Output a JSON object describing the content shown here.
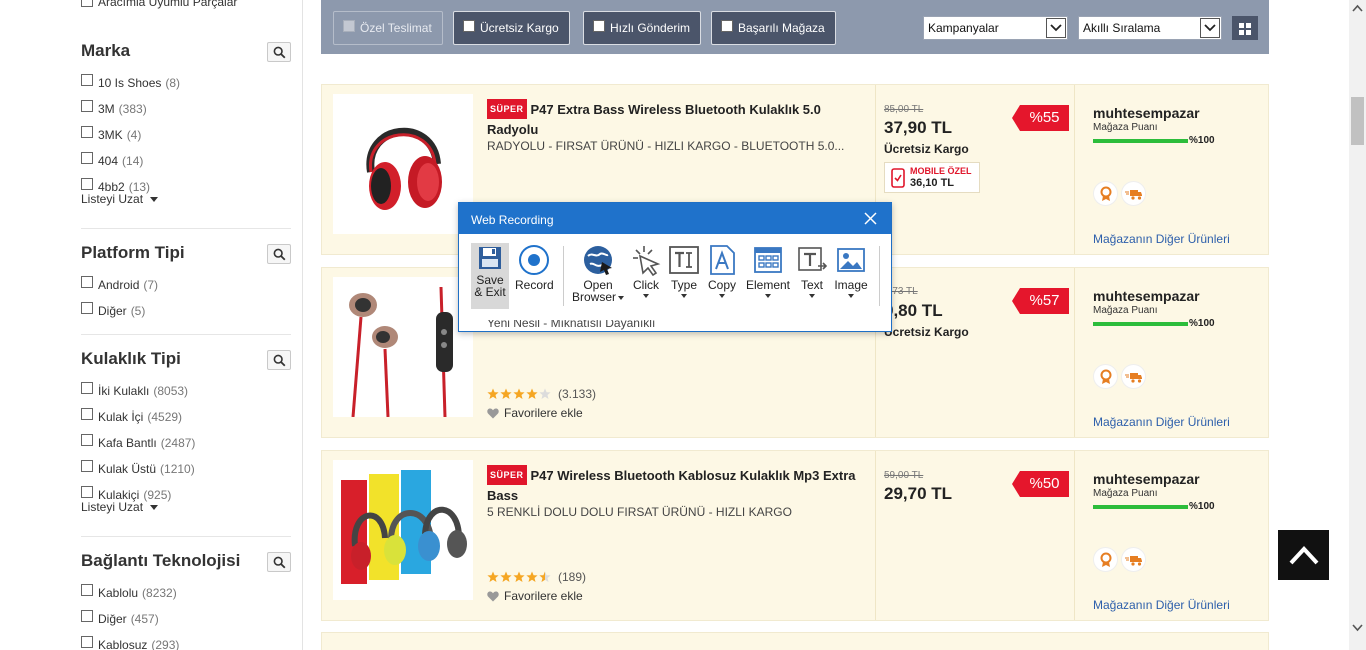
{
  "sidebar": {
    "cut_item": "Aracımla Uyumlu Parçalar",
    "expand_label": "Listeyi Uzat",
    "facets": [
      {
        "title": "Marka",
        "options": [
          {
            "label": "10 Is Shoes",
            "count": "(8)"
          },
          {
            "label": "3M",
            "count": "(383)"
          },
          {
            "label": "3MK",
            "count": "(4)"
          },
          {
            "label": "404",
            "count": "(14)"
          },
          {
            "label": "4bb2",
            "count": "(13)"
          }
        ]
      },
      {
        "title": "Platform Tipi",
        "options": [
          {
            "label": "Android",
            "count": "(7)"
          },
          {
            "label": "Diğer",
            "count": "(5)"
          }
        ]
      },
      {
        "title": "Kulaklık Tipi",
        "options": [
          {
            "label": "İki Kulaklı",
            "count": "(8053)"
          },
          {
            "label": "Kulak İçi",
            "count": "(4529)"
          },
          {
            "label": "Kafa Bantlı",
            "count": "(2487)"
          },
          {
            "label": "Kulak Üstü",
            "count": "(1210)"
          },
          {
            "label": "Kulakiçi",
            "count": "(925)"
          }
        ]
      },
      {
        "title": "Bağlantı Teknolojisi",
        "options": [
          {
            "label": "Kablolu",
            "count": "(8232)"
          },
          {
            "label": "Diğer",
            "count": "(457)"
          },
          {
            "label": "Kablosuz",
            "count": "(293)"
          }
        ]
      }
    ]
  },
  "filterbar": {
    "chips": [
      "Özel Teslimat",
      "Ücretsiz Kargo",
      "Hızlı Gönderim",
      "Başarılı Mağaza"
    ],
    "select_campaign": "Kampanyalar",
    "select_sort": "Akıllı Sıralama"
  },
  "products": [
    {
      "badge": "SÜPER",
      "title": "P47 Extra Bass Wireless Bluetooth Kulaklık 5.0 Radyolu",
      "subtitle": "RADYOLU - FIRSAT ÜRÜNÜ - HIZLI KARGO - BLUETOOTH 5.0...",
      "old_price": "85,00 TL",
      "price": "37,90 TL",
      "shipping": "Ücretsiz Kargo",
      "mobile_label": "MOBILE ÖZEL",
      "mobile_price": "36,10 TL",
      "discount": "%55",
      "store": "muhtesempazar",
      "store_score_label": "Mağaza Puanı",
      "store_score": "%100",
      "store_link": "Mağazanın Diğer Ürünleri"
    },
    {
      "subtitle_partial": "Yeni Nesil - Mıknatıslı Dayanıklı",
      "rating_count": "(3.133)",
      "rating_value": 4,
      "favorite": "Favorilere ekle",
      "old_price_partial": "5,73 TL",
      "price_partial": "9,80 TL",
      "shipping": "Ücretsiz Kargo",
      "discount": "%57",
      "store": "muhtesempazar",
      "store_score_label": "Mağaza Puanı",
      "store_score": "%100",
      "store_link": "Mağazanın Diğer Ürünleri"
    },
    {
      "badge": "SÜPER",
      "title": "P47 Wireless Bluetooth Kablosuz Kulaklık Mp3 Extra Bass",
      "subtitle": "5 RENKLİ DOLU DOLU FIRSAT ÜRÜNÜ - HIZLI KARGO",
      "rating_count": "(189)",
      "rating_value": 4.5,
      "favorite": "Favorilere ekle",
      "old_price": "59,00 TL",
      "price": "29,70 TL",
      "discount": "%50",
      "store": "muhtesempazar",
      "store_score_label": "Mağaza Puanı",
      "store_score": "%100",
      "store_link": "Mağazanın Diğer Ürünleri"
    }
  ],
  "web_recording": {
    "title": "Web Recording",
    "tools": [
      {
        "label": "Save",
        "label2": "& Exit",
        "icon": "save-icon"
      },
      {
        "label": "Record",
        "icon": "record-icon"
      },
      {
        "label": "Open",
        "label2": "Browser",
        "icon": "globe-icon"
      },
      {
        "label": "Click",
        "icon": "click-icon"
      },
      {
        "label": "Type",
        "icon": "type-icon"
      },
      {
        "label": "Copy",
        "icon": "copy-icon"
      },
      {
        "label": "Element",
        "icon": "element-icon"
      },
      {
        "label": "Text",
        "icon": "text-icon"
      },
      {
        "label": "Image",
        "icon": "image-icon"
      }
    ]
  },
  "colors": {
    "filterbar": "#8d99ad",
    "card_bg": "#fdf8e5",
    "discount": "#e5162c",
    "link": "#2d5fab",
    "popup_title": "#1f72cb",
    "score_bar": "#2cbd3b"
  }
}
